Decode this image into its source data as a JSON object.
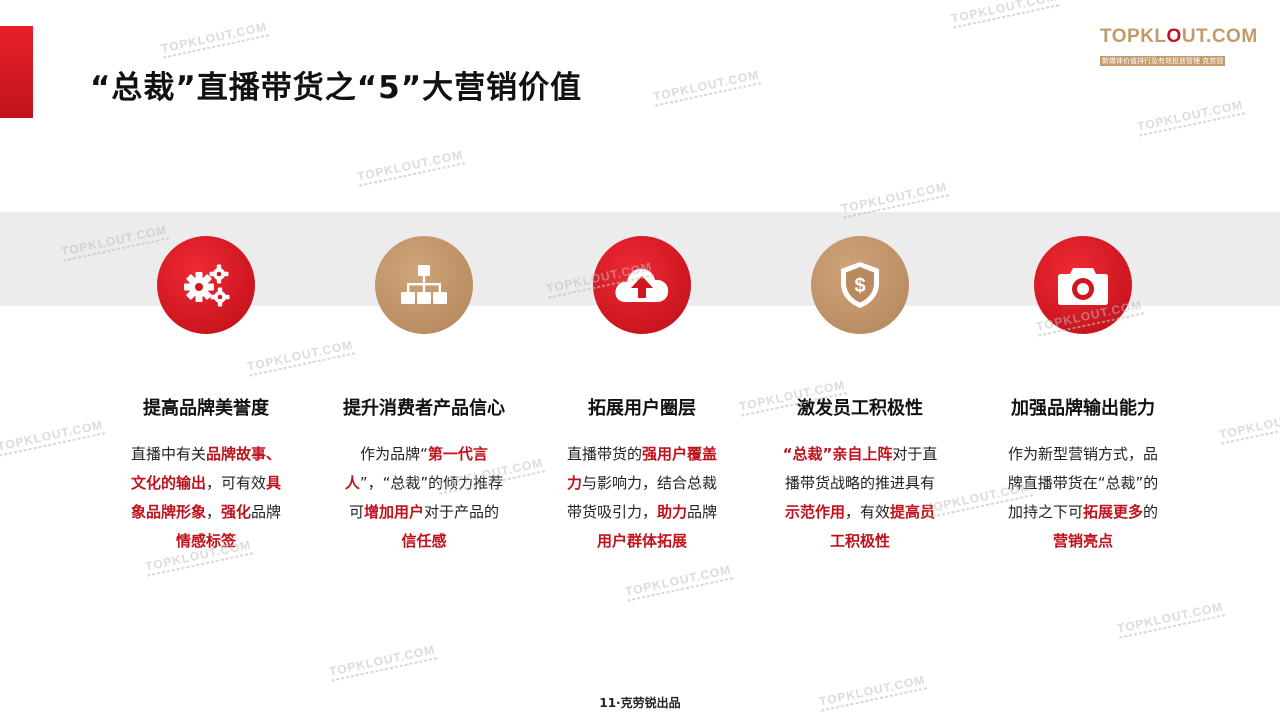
{
  "title": "“总裁”直播带货之“5”大营销价值",
  "logo": {
    "text_a": "TOPKL",
    "text_b": "O",
    "text_c": "UT.COM",
    "subtitle": "新媒体价值排行及有效投放管理 克劳锐"
  },
  "watermark": "TOPKLOUT.COM",
  "footer": "11·克劳锐出品",
  "colors": {
    "accent": "#c1121c",
    "gold": "#b98a60",
    "band": "#ececec"
  },
  "cards": [
    {
      "icon": "gears-icon",
      "circle": "red",
      "title": "提高品牌美誉度",
      "desc": [
        {
          "t": "直播中有关",
          "h": false
        },
        {
          "t": "品牌故事、文化的输出",
          "h": true
        },
        {
          "t": "，可有效",
          "h": false
        },
        {
          "t": "具象品牌形象",
          "h": true
        },
        {
          "t": "，",
          "h": false
        },
        {
          "t": "强化",
          "h": true
        },
        {
          "t": "品牌",
          "h": false
        },
        {
          "t": "情感标签",
          "h": true
        }
      ]
    },
    {
      "icon": "org-chart-icon",
      "circle": "gold",
      "title": "提升消费者产品信心",
      "desc": [
        {
          "t": "作为品牌“",
          "h": false
        },
        {
          "t": "第一代言人",
          "h": true
        },
        {
          "t": "”，“总裁”的倾力推荐可",
          "h": false
        },
        {
          "t": "增加用户",
          "h": true
        },
        {
          "t": "对于产品的",
          "h": false
        },
        {
          "t": "信任感",
          "h": true
        }
      ]
    },
    {
      "icon": "cloud-upload-icon",
      "circle": "red",
      "title": "拓展用户圈层",
      "desc": [
        {
          "t": "直播带货的",
          "h": false
        },
        {
          "t": "强用户覆盖力",
          "h": true
        },
        {
          "t": "与影响力，结合总裁带货吸引力，",
          "h": false
        },
        {
          "t": "助力",
          "h": true
        },
        {
          "t": "品牌",
          "h": false
        },
        {
          "t": "用户群体拓展",
          "h": true
        }
      ]
    },
    {
      "icon": "shield-dollar-icon",
      "circle": "gold",
      "title": "激发员工积极性",
      "desc": [
        {
          "t": "“总裁”亲自上阵",
          "h": true
        },
        {
          "t": "对于直播带货战略的推进具有",
          "h": false
        },
        {
          "t": "示范作用",
          "h": true
        },
        {
          "t": "，有效",
          "h": false
        },
        {
          "t": "提高员工积极性",
          "h": true
        }
      ]
    },
    {
      "icon": "camera-icon",
      "circle": "red",
      "title": "加强品牌输出能力",
      "desc": [
        {
          "t": "作为新型营销方式，品牌直播带货在“总裁”的加持之下可",
          "h": false
        },
        {
          "t": "拓展更多",
          "h": true
        },
        {
          "t": "的",
          "h": false
        },
        {
          "t": "营销亮点",
          "h": true
        }
      ]
    }
  ]
}
